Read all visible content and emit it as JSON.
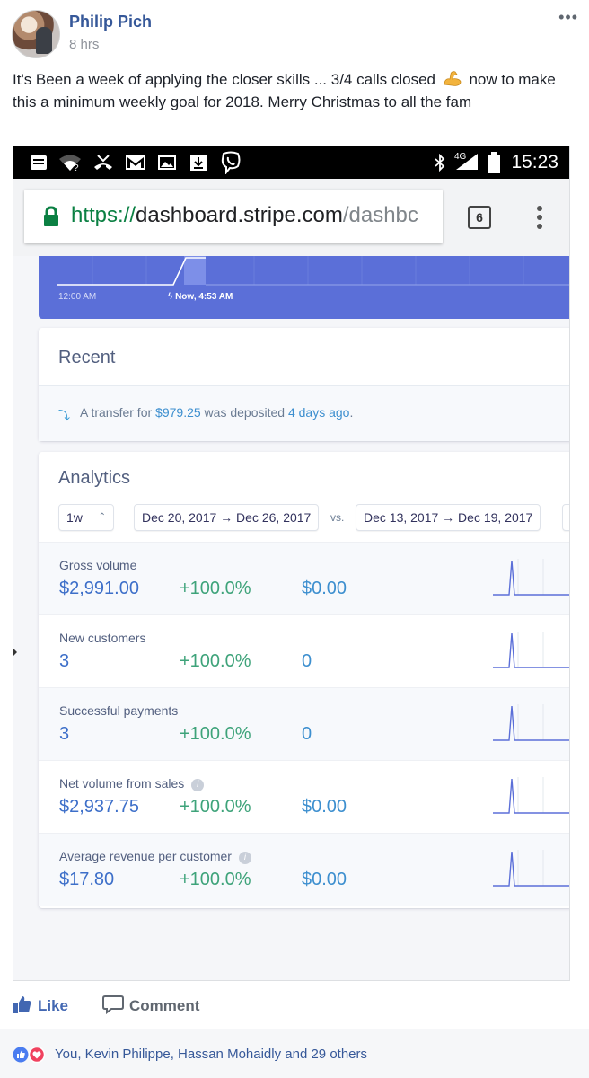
{
  "post": {
    "author": "Philip Pich",
    "time": "8 hrs",
    "more_label": "•••",
    "text_before_emoji": "It's Been a week of applying the closer skills ... 3/4 calls closed",
    "emoji": "flexed-biceps",
    "text_after_emoji": "now to make this a minimum weekly goal for 2018. Merry Christmas to all the fam"
  },
  "status_bar": {
    "time": "15:23",
    "network": "4G",
    "icons": [
      "notification-icon",
      "wifi-icon",
      "missed-call-icon",
      "gmail-icon",
      "image-icon",
      "download-icon",
      "viber-icon",
      "bluetooth-icon",
      "signal-icon",
      "battery-icon"
    ]
  },
  "browser": {
    "url_scheme": "https://",
    "url_host": "dashboard.stripe.com",
    "url_path": "/dashbc",
    "tab_count": "6"
  },
  "today_chart": {
    "start_label": "12:00 AM",
    "now_label": "Now, 4:53 AM",
    "bar_color": "#5b6fd8"
  },
  "recent": {
    "title": "Recent",
    "transfer_prefix": "A transfer for",
    "transfer_amount": "$979.25",
    "transfer_middle": "was deposited",
    "transfer_when": "4 days ago",
    "transfer_suffix": "."
  },
  "analytics": {
    "title": "Analytics",
    "period": "1w",
    "range_current": "Dec 20, 2017 → Dec 26, 2017",
    "vs_label": "vs.",
    "range_previous": "Dec 13, 2017 → Dec 19, 2017",
    "metrics": [
      {
        "name": "Gross volume",
        "value": "$2,991.00",
        "change": "+100.0%",
        "previous": "$0.00",
        "info": false
      },
      {
        "name": "New customers",
        "value": "3",
        "change": "+100.0%",
        "previous": "0",
        "info": false
      },
      {
        "name": "Successful payments",
        "value": "3",
        "change": "+100.0%",
        "previous": "0",
        "info": false
      },
      {
        "name": "Net volume from sales",
        "value": "$2,937.75",
        "change": "+100.0%",
        "previous": "$0.00",
        "info": true
      },
      {
        "name": "Average revenue per customer",
        "value": "$17.80",
        "change": "+100.0%",
        "previous": "$0.00",
        "info": true
      }
    ]
  },
  "actions": {
    "like_label": "Like",
    "comment_label": "Comment"
  },
  "reactions": {
    "summary": "You, Kevin Philippe, Hassan Mohaidly and 29 others",
    "types": [
      "like",
      "love"
    ]
  },
  "colors": {
    "facebook_blue": "#4267b2",
    "stripe_purple": "#5b6fd8",
    "positive_green": "#3ea37a",
    "value_blue": "#3d6fc9"
  }
}
